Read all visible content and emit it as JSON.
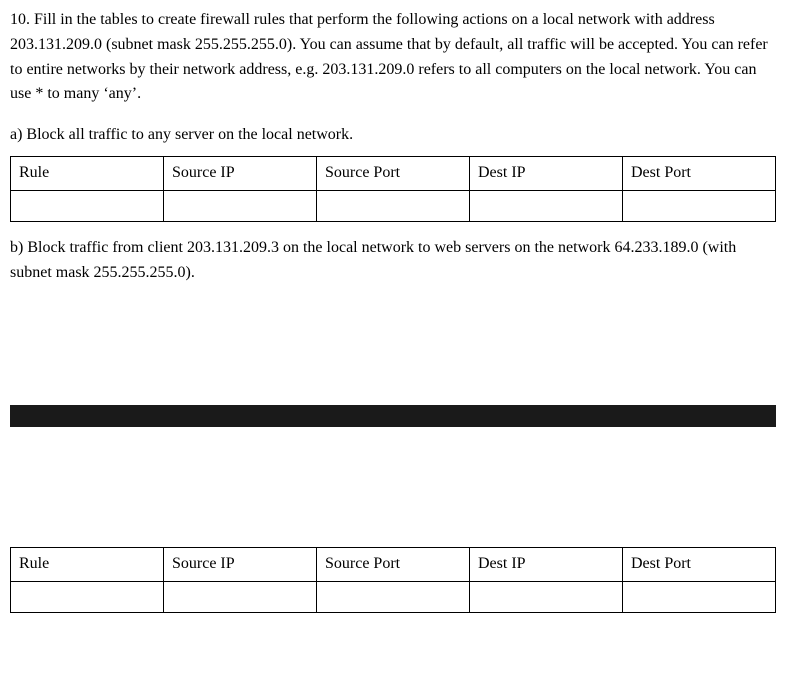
{
  "intro": "10. Fill in the tables to create firewall rules that perform the following actions on a local network with address 203.131.209.0 (subnet mask 255.255.255.0). You can assume that by default, all traffic will be accepted. You can refer to entire networks by their network address, e.g. 203.131.209.0 refers to all computers on the local network. You can use * to many ‘any’.",
  "part_a": {
    "label": "a) Block all traffic to any server on the local network.",
    "headers": [
      "Rule",
      "Source IP",
      "Source Port",
      "Dest IP",
      "Dest Port"
    ]
  },
  "part_b": {
    "label": "b) Block traffic from client 203.131.209.3 on the local network to web servers on the network 64.233.189.0 (with subnet mask 255.255.255.0).",
    "headers": [
      "Rule",
      "Source IP",
      "Source Port",
      "Dest IP",
      "Dest Port"
    ]
  }
}
